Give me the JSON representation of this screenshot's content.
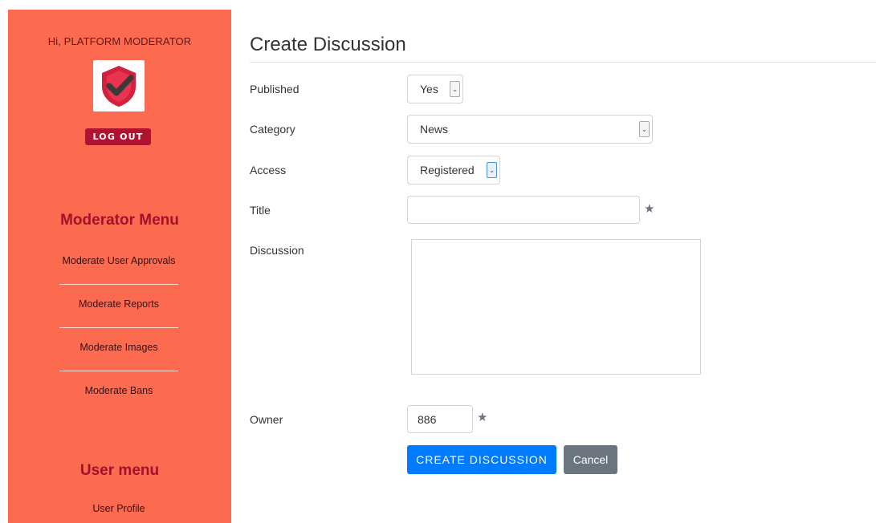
{
  "sidebar": {
    "greeting": "Hi, PLATFORM MODERATOR",
    "logout_label": "LOG OUT",
    "moderator_menu": {
      "heading": "Moderator Menu",
      "items": [
        {
          "label": "Moderate User Approvals"
        },
        {
          "label": "Moderate Reports"
        },
        {
          "label": "Moderate Images"
        },
        {
          "label": "Moderate Bans"
        }
      ]
    },
    "user_menu": {
      "heading": "User menu",
      "items": [
        {
          "label": "User Profile"
        }
      ]
    }
  },
  "form": {
    "title": "Create Discussion",
    "published": {
      "label": "Published",
      "value": "Yes"
    },
    "category": {
      "label": "Category",
      "value": "News"
    },
    "access": {
      "label": "Access",
      "value": "Registered"
    },
    "title_field": {
      "label": "Title",
      "value": ""
    },
    "discussion": {
      "label": "Discussion",
      "value": ""
    },
    "owner": {
      "label": "Owner",
      "value": "886"
    },
    "submit_label": "CREATE DISCUSSION",
    "cancel_label": "Cancel"
  },
  "colors": {
    "sidebar_bg": "#fc6a50",
    "menu_heading": "#a3112b",
    "logout_bg": "#b0122f",
    "primary": "#007bff",
    "secondary": "#6c757d"
  },
  "icons": {
    "avatar": "shield-check-icon",
    "dropdown": "chevron-down-icon",
    "required": "star-icon"
  }
}
